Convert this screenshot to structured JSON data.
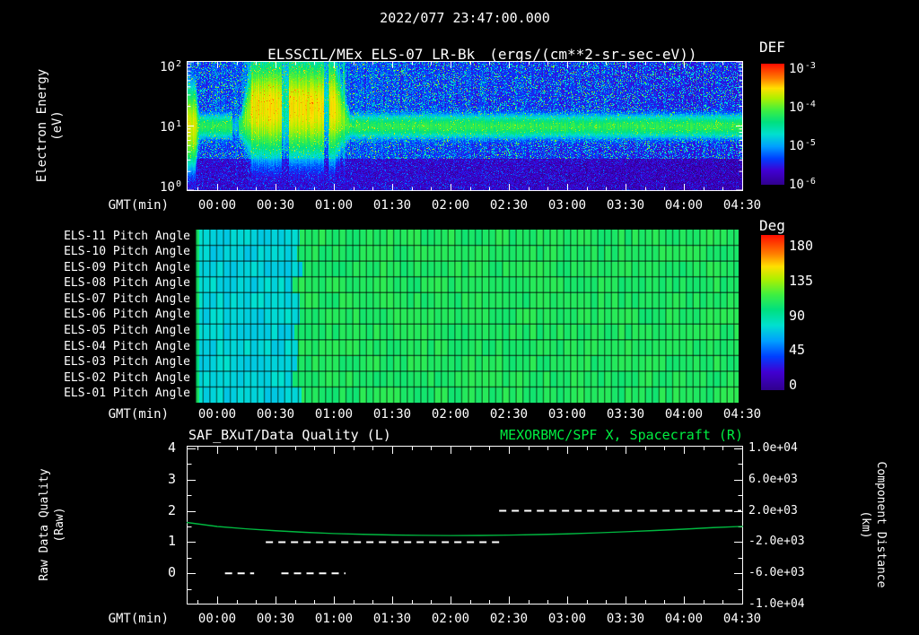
{
  "header": {
    "timestamp": "2022/077 23:47:00.000",
    "title": "ELSSCIL/MEx ELS-07 LR-Bk",
    "units": "(ergs/(cm**2-sr-sec-eV))",
    "colorbar1_title": "DEF",
    "colorbar2_title": "Deg"
  },
  "time_axis": {
    "label": "GMT(min)",
    "ticks": [
      "00:00",
      "00:30",
      "01:00",
      "01:30",
      "02:00",
      "02:30",
      "03:00",
      "03:30",
      "04:00",
      "04:30"
    ]
  },
  "spectrogram": {
    "ylabel": "Electron Energy",
    "ylabel_units": "(eV)",
    "yticks": [
      {
        "base": "10",
        "exp": "2"
      },
      {
        "base": "10",
        "exp": "1"
      },
      {
        "base": "10",
        "exp": "0"
      }
    ],
    "colorbar_ticks": [
      {
        "base": "10",
        "exp": "-3"
      },
      {
        "base": "10",
        "exp": "-4"
      },
      {
        "base": "10",
        "exp": "-5"
      },
      {
        "base": "10",
        "exp": "-6"
      }
    ]
  },
  "pitch": {
    "rows": [
      "ELS-11 Pitch Angle",
      "ELS-10 Pitch Angle",
      "ELS-09 Pitch Angle",
      "ELS-08 Pitch Angle",
      "ELS-07 Pitch Angle",
      "ELS-06 Pitch Angle",
      "ELS-05 Pitch Angle",
      "ELS-04 Pitch Angle",
      "ELS-03 Pitch Angle",
      "ELS-02 Pitch Angle",
      "ELS-01 Pitch Angle"
    ],
    "colorbar_ticks": [
      "180",
      "135",
      "90",
      "45",
      "0"
    ]
  },
  "quality": {
    "title_left": "SAF_BXuT/Data Quality (L)",
    "title_right": "MEXORBMC/SPF X, Spacecraft (R)",
    "ylabel_left": "Raw Data Quality",
    "ylabel_left_units": "(Raw)",
    "ylabel_right": "Component Distance",
    "ylabel_right_units": "(km)",
    "left_ticks": [
      "4",
      "3",
      "2",
      "1",
      "0"
    ],
    "right_ticks": [
      "1.0e+04",
      "6.0e+03",
      "2.0e+03",
      "-2.0e+03",
      "-6.0e+03",
      "-1.0e+04"
    ]
  },
  "colors": {
    "background": "#000000",
    "text": "#ffffff",
    "accent_green": "#00ef41",
    "curve_green": "#00b840"
  },
  "chart_data": {
    "shared_x_axis": {
      "label": "GMT(min)",
      "tick_labels": [
        "00:00",
        "00:30",
        "01:00",
        "01:30",
        "02:00",
        "02:30",
        "03:00",
        "03:30",
        "04:00",
        "04:30"
      ],
      "tick_interval_min": 30,
      "range_min": [
        -15.7,
        270.5
      ],
      "date_doy": "2022/077"
    },
    "colormap": [
      [
        0,
        "#30008c"
      ],
      [
        0.12,
        "#4100d2"
      ],
      [
        0.22,
        "#0040ff"
      ],
      [
        0.32,
        "#00a0ff"
      ],
      [
        0.42,
        "#00e0d0"
      ],
      [
        0.52,
        "#00e080"
      ],
      [
        0.62,
        "#40f040"
      ],
      [
        0.72,
        "#b0f000"
      ],
      [
        0.8,
        "#ffe000"
      ],
      [
        0.88,
        "#ff8000"
      ],
      [
        1,
        "#ff1000"
      ]
    ],
    "panels": [
      {
        "id": "electron_spectrogram",
        "type": "heatmap",
        "title": "ELSSCIL/MEx ELS-07 LR-Bk",
        "units": "ergs/(cm**2-sr-sec-eV)",
        "y_axis": {
          "label": "Electron Energy (eV)",
          "scale": "log",
          "range_ev": [
            1,
            100
          ]
        },
        "color_axis": {
          "label": "DEF",
          "scale": "log",
          "range": [
            1e-06,
            0.001
          ]
        },
        "features": {
          "persistent_band": {
            "center_ev": 10,
            "width_decades": 0.085,
            "peak_def": 5e-05
          },
          "enhancement": {
            "start_min": 12,
            "end_min": 68,
            "center_ev": 19,
            "width_decades": 0.3,
            "peak_def": 0.00022
          },
          "left_edge_burst": {
            "end_min": -9.5,
            "peak_def": 0.00016
          },
          "high_energy_streaks": {
            "start_min": 56.5,
            "end_min": 66,
            "center_ev": 28
          },
          "band_gaps_min": [
            [
              7.5,
              11,
              0.9
            ],
            [
              33,
              36.5,
              1.1
            ],
            [
              54.5,
              57.5,
              1.3
            ]
          ],
          "background_def": 2.5e-06,
          "low_energy_background_def": 1.3e-06
        }
      },
      {
        "id": "pitch_angles",
        "type": "heatmap",
        "rows": [
          "ELS-11",
          "ELS-10",
          "ELS-09",
          "ELS-08",
          "ELS-07",
          "ELS-06",
          "ELS-05",
          "ELS-04",
          "ELS-03",
          "ELS-02",
          "ELS-01"
        ],
        "color_axis": {
          "label": "Deg",
          "range_deg": [
            0,
            180
          ],
          "ticks": [
            180,
            135,
            90,
            45,
            0
          ]
        },
        "data_range_min": [
          -11.1,
          267.7
        ],
        "sweep_period_min": 3.5,
        "segments": [
          {
            "start_min": -11.1,
            "end_min": 41,
            "pitch_deg": 72
          },
          {
            "start_min": 41,
            "end_min": 267.7,
            "pitch_deg": 102
          }
        ]
      },
      {
        "id": "quality_and_spacecraft",
        "type": "line",
        "title_left": "SAF_BXuT/Data Quality (L)",
        "title_right": "MEXORBMC/SPF X, Spacecraft (R)",
        "left_axis": {
          "label": "Raw Data Quality (Raw)",
          "range": [
            -1,
            4
          ],
          "ticks": [
            4,
            3,
            2,
            1,
            0
          ]
        },
        "right_axis": {
          "label": "Component Distance (km)",
          "range_km": [
            -10000,
            10000
          ],
          "ticks_km": [
            10000,
            6000,
            2000,
            -2000,
            -6000,
            -10000
          ]
        },
        "series": [
          {
            "name": "raw_data_quality",
            "axis": "left",
            "style": "dashed",
            "color": "#ffffff",
            "segments": [
              {
                "t_min": [
                  4,
                  19
                ],
                "value": 0
              },
              {
                "t_min": [
                  33,
                  66
                ],
                "value": 0
              },
              {
                "t_min": [
                  25,
                  145
                ],
                "value": 1
              },
              {
                "t_min": [
                  145,
                  270
                ],
                "value": 2
              }
            ]
          },
          {
            "name": "spacecraft_x_component",
            "axis": "right",
            "style": "solid",
            "color": "#00b840",
            "t_min": [
              -15.7,
              0,
              15,
              30,
              45,
              60,
              75,
              90,
              105,
              120,
              135,
              150,
              165,
              180,
              195,
              210,
              225,
              240,
              255,
              270.5
            ],
            "km": [
              520,
              0,
              -300,
              -540,
              -740,
              -900,
              -1010,
              -1090,
              -1140,
              -1160,
              -1150,
              -1110,
              -1040,
              -940,
              -820,
              -680,
              -520,
              -340,
              -140,
              20
            ]
          }
        ]
      }
    ]
  }
}
